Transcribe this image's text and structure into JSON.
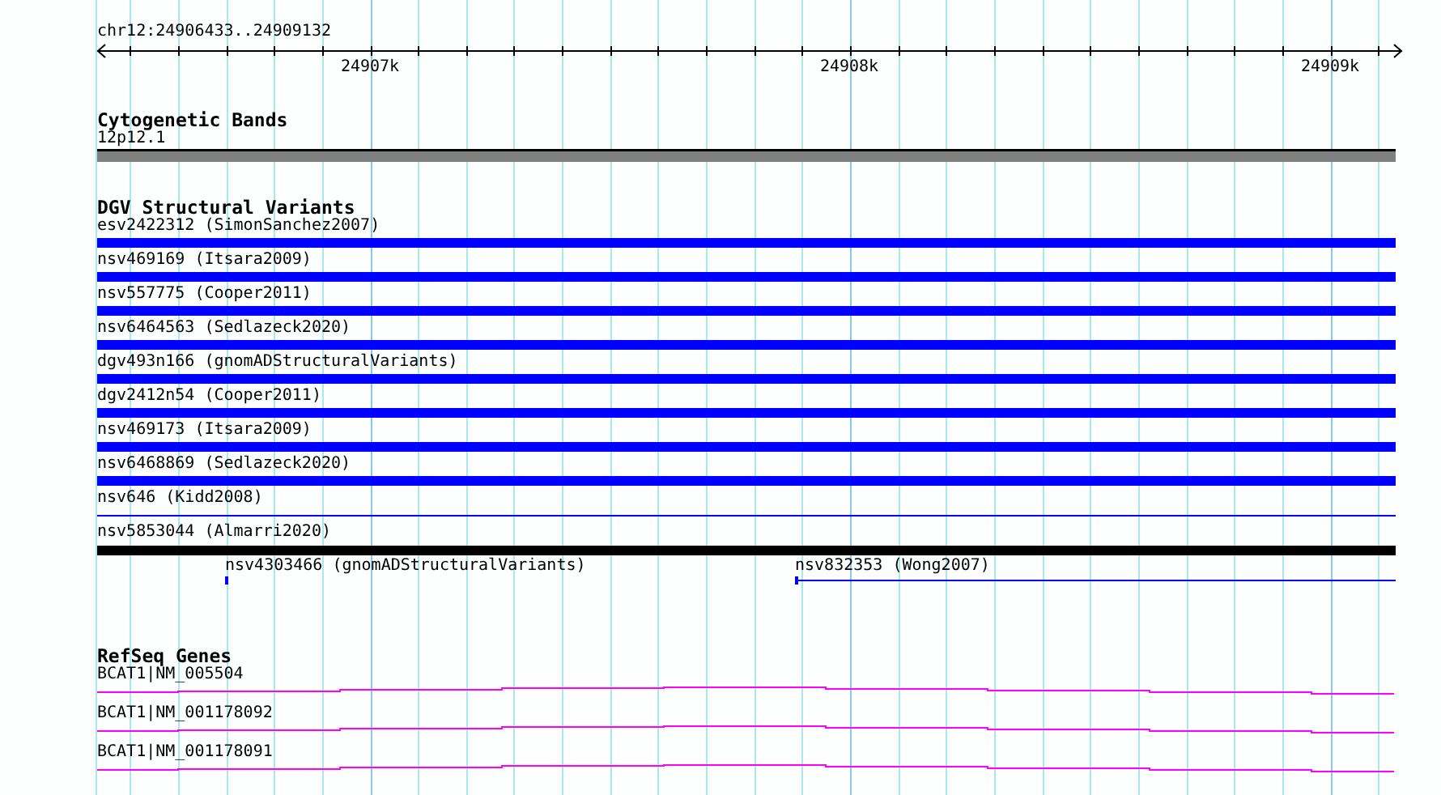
{
  "location": "chr12:24906433..24909132",
  "ruler": {
    "ticks": [
      "24907k",
      "24908k",
      "24909k"
    ]
  },
  "tracks": [
    {
      "kind": "bands",
      "title": "Cytogenetic Bands",
      "rows": [
        [
          {
            "label": "12p12.1",
            "kind": "band",
            "color": "#808080"
          }
        ]
      ]
    },
    {
      "kind": "variants",
      "title": "DGV Structural Variants",
      "rows": [
        [
          {
            "label": "esv2422312 (SimonSanchez2007)",
            "kind": "bar",
            "color": "#0000ff"
          }
        ],
        [
          {
            "label": "nsv469169 (Itsara2009)",
            "kind": "bar",
            "color": "#0000ff"
          }
        ],
        [
          {
            "label": "nsv557775 (Cooper2011)",
            "kind": "bar",
            "color": "#0000ff"
          }
        ],
        [
          {
            "label": "nsv6464563 (Sedlazeck2020)",
            "kind": "bar",
            "color": "#0000ff"
          }
        ],
        [
          {
            "label": "dgv493n166 (gnomADStructuralVariants)",
            "kind": "bar",
            "color": "#0000ff"
          }
        ],
        [
          {
            "label": "dgv2412n54 (Cooper2011)",
            "kind": "bar",
            "color": "#0000ff"
          }
        ],
        [
          {
            "label": "nsv469173 (Itsara2009)",
            "kind": "bar",
            "color": "#0000ff"
          }
        ],
        [
          {
            "label": "nsv6468869 (Sedlazeck2020)",
            "kind": "bar",
            "color": "#0000ff"
          }
        ],
        [
          {
            "label": "nsv646 (Kidd2008)",
            "kind": "line",
            "color": "#0000ff"
          }
        ],
        [
          {
            "label": "nsv5853044 (Almarri2020)",
            "kind": "bar",
            "color": "#000000"
          }
        ],
        [
          {
            "label": "nsv4303466 (gnomADStructuralVariants)",
            "kind": "tick",
            "color": "#0000ff"
          },
          {
            "label": "nsv832353 (Wong2007)",
            "kind": "span",
            "color": "#0000ff"
          }
        ]
      ]
    },
    {
      "kind": "genes",
      "title": "RefSeq Genes",
      "rows": [
        [
          {
            "label": "BCAT1|NM_005504",
            "kind": "gene",
            "color": "#ff00ff"
          }
        ],
        [
          {
            "label": "BCAT1|NM_001178092",
            "kind": "gene",
            "color": "#ff00ff"
          }
        ],
        [
          {
            "label": "BCAT1|NM_001178091",
            "kind": "gene",
            "color": "#ff00ff"
          }
        ]
      ]
    }
  ]
}
